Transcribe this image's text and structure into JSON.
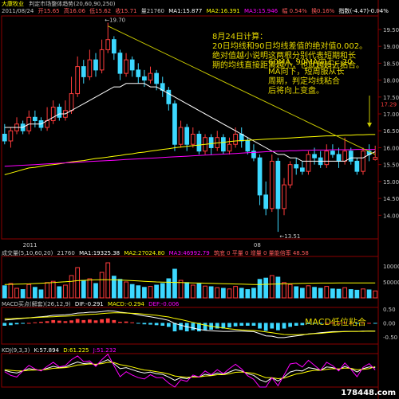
{
  "header": {
    "stock_name": "大康牧业",
    "indicator_title": "判定市场整体趋势(20,60,90,250)",
    "date": "2011/08/24",
    "open": "开15.65",
    "high": "高16.06",
    "low": "低15.62",
    "close": "收15.71",
    "volume": "量21760",
    "ma1": "MA1:15.877",
    "ma2": "MA2:16.391",
    "ma3": "MA3:15.946",
    "amplitude": "幅 0.54%",
    "turnover": "换0.16%",
    "index_label": "指数(-4.47)-0.04%"
  },
  "annotations": {
    "aug24_title": "8月24日计算：",
    "aug24_text": "20日均线和90日均线差值的绝对值0.002。\n绝对值越小说明这两根分别代表短期和长\n期的均线直接距离越小，也就越趋近粘合。",
    "ma60_text": "60MA, 90MA向上，20\nMA向下，短周服从长\n周期，判定均线粘合\n后将向上变盘。",
    "macd_text": "MACD低位粘合"
  },
  "volume_panel": {
    "label": "成交量(5,10,60,20)",
    "value": "21760",
    "ma1": "MA1:19325.38",
    "ma2": "MA2:27024.80",
    "ma3": "MA3:46992.79",
    "extra": "筑底 0  平量 0  增量 0  量能倍率 48.58"
  },
  "macd_panel": {
    "label": "MACD买点(解套)(26,12,9)",
    "dif": "DIF:-0.291",
    "dea": "MACD:-0.294",
    "macd": "DEF:-0.006"
  },
  "kdj_panel": {
    "label": "KDJ(9,3,3)",
    "k": "K:57.894",
    "d": "D:61.225",
    "j": "J:51.232"
  },
  "watermark": "178448.com",
  "chart_data": {
    "type": "candlestick",
    "y_axis": {
      "ticks": [
        14.0,
        14.5,
        15.0,
        15.5,
        16.0,
        16.5,
        17.0,
        17.5,
        18.0,
        18.5,
        19.0,
        19.5
      ],
      "ylim": [
        13.3,
        19.9
      ]
    },
    "x_labels": [
      {
        "index": 3,
        "text": "2011"
      },
      {
        "index": 41,
        "text": "08"
      }
    ],
    "marks": {
      "high_label": "19.70",
      "high_index": 17,
      "low_label": "13.51",
      "low_index": 45,
      "current_price_tag": "17.29"
    },
    "colors": {
      "up": "#ff3c3c",
      "down": "#3cd8ff",
      "ma20": "#ffffff",
      "ma60": "#ffff00",
      "ma90": "#ff00ff",
      "trend": "#c8c800"
    },
    "candles": [
      [
        16.4,
        16.2,
        16.7,
        16.1
      ],
      [
        16.2,
        16.5,
        16.6,
        16.0
      ],
      [
        16.5,
        16.7,
        16.9,
        16.4
      ],
      [
        16.7,
        16.5,
        16.8,
        16.4
      ],
      [
        16.5,
        16.9,
        17.1,
        16.4
      ],
      [
        16.9,
        16.8,
        17.1,
        16.6
      ],
      [
        16.8,
        16.6,
        16.9,
        16.5
      ],
      [
        16.6,
        16.8,
        17.2,
        16.5
      ],
      [
        16.8,
        17.2,
        17.4,
        16.7
      ],
      [
        17.2,
        16.9,
        17.3,
        16.8
      ],
      [
        16.9,
        17.1,
        17.4,
        16.8
      ],
      [
        17.1,
        17.6,
        18.1,
        17.0
      ],
      [
        17.6,
        18.4,
        18.7,
        17.5
      ],
      [
        18.4,
        18.1,
        18.6,
        17.9
      ],
      [
        18.1,
        18.6,
        18.9,
        18.0
      ],
      [
        18.6,
        18.3,
        18.8,
        18.1
      ],
      [
        18.3,
        18.9,
        19.2,
        18.2
      ],
      [
        18.9,
        19.2,
        19.7,
        18.8
      ],
      [
        19.2,
        18.8,
        19.3,
        18.6
      ],
      [
        18.8,
        18.2,
        18.9,
        18.0
      ],
      [
        18.2,
        18.6,
        18.8,
        18.1
      ],
      [
        18.6,
        18.3,
        18.7,
        18.1
      ],
      [
        18.3,
        18.1,
        18.5,
        17.9
      ],
      [
        18.1,
        18.0,
        18.3,
        17.8
      ],
      [
        18.0,
        18.2,
        18.4,
        17.9
      ],
      [
        18.2,
        17.9,
        18.3,
        17.7
      ],
      [
        17.9,
        17.7,
        18.1,
        17.5
      ],
      [
        17.7,
        17.3,
        17.8,
        17.1
      ],
      [
        17.3,
        16.1,
        17.4,
        15.9
      ],
      [
        16.1,
        16.6,
        16.8,
        16.0
      ],
      [
        16.6,
        16.1,
        16.7,
        15.9
      ],
      [
        16.1,
        16.4,
        16.6,
        16.0
      ],
      [
        16.4,
        15.9,
        16.5,
        15.8
      ],
      [
        15.9,
        16.3,
        16.4,
        15.8
      ],
      [
        16.3,
        16.0,
        16.4,
        15.8
      ],
      [
        16.0,
        16.3,
        16.5,
        15.9
      ],
      [
        16.3,
        15.9,
        16.4,
        15.8
      ],
      [
        15.9,
        16.1,
        16.3,
        15.8
      ],
      [
        16.1,
        16.4,
        16.6,
        16.0
      ],
      [
        16.4,
        16.2,
        16.6,
        16.0
      ],
      [
        16.2,
        15.9,
        16.3,
        15.8
      ],
      [
        15.9,
        15.7,
        16.1,
        15.6
      ],
      [
        15.7,
        14.6,
        15.8,
        14.3
      ],
      [
        14.6,
        14.2,
        15.0,
        14.0
      ],
      [
        14.2,
        15.6,
        15.8,
        14.1
      ],
      [
        15.6,
        14.2,
        15.7,
        13.51
      ],
      [
        14.2,
        14.9,
        15.1,
        14.0
      ],
      [
        14.9,
        15.5,
        15.6,
        14.8
      ],
      [
        15.5,
        15.4,
        15.7,
        15.2
      ],
      [
        15.4,
        15.3,
        15.6,
        15.2
      ],
      [
        15.3,
        15.8,
        15.9,
        15.2
      ],
      [
        15.8,
        15.7,
        16.0,
        15.5
      ],
      [
        15.7,
        15.5,
        15.9,
        15.4
      ],
      [
        15.5,
        15.9,
        16.1,
        15.4
      ],
      [
        15.9,
        15.8,
        16.1,
        15.7
      ],
      [
        15.8,
        15.6,
        16.0,
        15.4
      ],
      [
        15.6,
        15.9,
        16.3,
        15.5
      ],
      [
        15.9,
        15.6,
        16.0,
        15.5
      ],
      [
        15.6,
        15.3,
        15.7,
        15.2
      ],
      [
        15.3,
        15.9,
        16.0,
        15.2
      ],
      [
        15.9,
        15.8,
        16.1,
        15.6
      ],
      [
        15.65,
        15.71,
        16.06,
        15.62
      ]
    ],
    "ma20": [
      16.6,
      16.6,
      16.6,
      16.6,
      16.7,
      16.7,
      16.7,
      16.8,
      16.9,
      17.0,
      17.0,
      17.1,
      17.2,
      17.3,
      17.4,
      17.5,
      17.6,
      17.7,
      17.8,
      17.8,
      17.9,
      17.9,
      17.9,
      17.9,
      17.8,
      17.8,
      17.7,
      17.6,
      17.5,
      17.4,
      17.3,
      17.2,
      17.1,
      17.0,
      16.9,
      16.8,
      16.7,
      16.6,
      16.5,
      16.4,
      16.3,
      16.2,
      16.1,
      16.0,
      15.9,
      15.8,
      15.8,
      15.7,
      15.7,
      15.6,
      15.6,
      15.6,
      15.6,
      15.6,
      15.6,
      15.6,
      15.6,
      15.7,
      15.7,
      15.7,
      15.8,
      15.88
    ],
    "ma60": [
      15.2,
      15.25,
      15.3,
      15.35,
      15.4,
      15.42,
      15.45,
      15.48,
      15.5,
      15.52,
      15.55,
      15.58,
      15.6,
      15.62,
      15.65,
      15.68,
      15.7,
      15.72,
      15.75,
      15.77,
      15.8,
      15.82,
      15.85,
      15.87,
      15.9,
      15.92,
      15.95,
      15.97,
      16.0,
      16.02,
      16.04,
      16.06,
      16.08,
      16.1,
      16.12,
      16.14,
      16.16,
      16.18,
      16.2,
      16.21,
      16.22,
      16.23,
      16.24,
      16.25,
      16.26,
      16.27,
      16.28,
      16.29,
      16.3,
      16.31,
      16.32,
      16.33,
      16.34,
      16.35,
      16.35,
      16.36,
      16.37,
      16.37,
      16.38,
      16.38,
      16.39,
      16.39
    ],
    "ma90": [
      15.45,
      15.46,
      15.47,
      15.48,
      15.49,
      15.5,
      15.51,
      15.52,
      15.53,
      15.54,
      15.55,
      15.56,
      15.57,
      15.58,
      15.59,
      15.6,
      15.61,
      15.62,
      15.63,
      15.64,
      15.65,
      15.66,
      15.67,
      15.68,
      15.69,
      15.7,
      15.71,
      15.72,
      15.73,
      15.74,
      15.75,
      15.76,
      15.77,
      15.78,
      15.79,
      15.8,
      15.81,
      15.82,
      15.83,
      15.84,
      15.85,
      15.86,
      15.87,
      15.88,
      15.89,
      15.9,
      15.9,
      15.91,
      15.91,
      15.92,
      15.92,
      15.93,
      15.93,
      15.93,
      15.94,
      15.94,
      15.94,
      15.94,
      15.95,
      15.95,
      15.95,
      15.95
    ],
    "trendline": {
      "from": [
        17,
        19.6
      ],
      "to": [
        61,
        15.8
      ]
    },
    "volume": {
      "ylim": [
        0,
        130000
      ],
      "ticks": [
        50000,
        100000
      ],
      "bars": [
        38000,
        45000,
        30000,
        26000,
        42000,
        33000,
        25000,
        48000,
        52000,
        35000,
        40000,
        70000,
        95000,
        55000,
        60000,
        45000,
        80000,
        110000,
        68000,
        58000,
        50000,
        42000,
        38000,
        33000,
        36000,
        40000,
        45000,
        60000,
        90000,
        55000,
        48000,
        40000,
        44000,
        37000,
        35000,
        32000,
        30000,
        28000,
        36000,
        30000,
        26000,
        30000,
        58000,
        62000,
        70000,
        65000,
        48000,
        42000,
        35000,
        30000,
        38000,
        33000,
        30000,
        36000,
        28000,
        27000,
        32000,
        26000,
        24000,
        28000,
        25000,
        21760
      ],
      "ma": [
        42000,
        42500,
        43000,
        43500,
        44000,
        45000,
        46000,
        47000,
        48000,
        49500,
        50500,
        52000,
        54000,
        55000,
        56000,
        56500,
        57000,
        57000,
        56500,
        56000,
        55000,
        54000,
        53000,
        52000,
        51000,
        50000,
        49500,
        49000,
        48500,
        48000,
        47500,
        47000,
        46500,
        46000,
        45500,
        45000,
        44500,
        44000,
        43500,
        43000,
        42500,
        42000,
        42000,
        42500,
        43000,
        43500,
        44000,
        44500,
        45000,
        45500,
        46000,
        46200,
        46400,
        46500,
        46600,
        46700,
        46800,
        46850,
        46900,
        46950,
        46980,
        46993
      ]
    },
    "macd": {
      "ylim": [
        -0.75,
        0.55
      ],
      "ticks": [
        0.5,
        0.0,
        -0.5
      ],
      "hist": [
        -0.1,
        -0.08,
        -0.05,
        -0.03,
        0.0,
        0.02,
        0.04,
        0.06,
        0.1,
        0.08,
        0.06,
        0.09,
        0.14,
        0.1,
        0.12,
        0.09,
        0.13,
        0.16,
        0.1,
        0.04,
        0.05,
        0.02,
        -0.02,
        -0.05,
        -0.06,
        -0.08,
        -0.1,
        -0.14,
        -0.3,
        -0.25,
        -0.3,
        -0.26,
        -0.3,
        -0.26,
        -0.24,
        -0.2,
        -0.2,
        -0.16,
        -0.12,
        -0.1,
        -0.1,
        -0.1,
        -0.2,
        -0.28,
        -0.2,
        -0.26,
        -0.2,
        -0.14,
        -0.1,
        -0.08,
        -0.04,
        -0.03,
        -0.02,
        0.0,
        0.01,
        0.0,
        0.02,
        0.0,
        -0.02,
        0.01,
        0.0,
        -0.006
      ],
      "dif": [
        0.1,
        0.12,
        0.14,
        0.16,
        0.18,
        0.2,
        0.22,
        0.24,
        0.27,
        0.28,
        0.29,
        0.31,
        0.35,
        0.36,
        0.38,
        0.38,
        0.4,
        0.43,
        0.42,
        0.38,
        0.36,
        0.33,
        0.29,
        0.25,
        0.22,
        0.18,
        0.14,
        0.09,
        -0.02,
        -0.08,
        -0.14,
        -0.18,
        -0.23,
        -0.26,
        -0.28,
        -0.29,
        -0.3,
        -0.3,
        -0.29,
        -0.29,
        -0.3,
        -0.31,
        -0.38,
        -0.46,
        -0.47,
        -0.52,
        -0.52,
        -0.49,
        -0.46,
        -0.43,
        -0.39,
        -0.37,
        -0.35,
        -0.33,
        -0.31,
        -0.31,
        -0.3,
        -0.3,
        -0.3,
        -0.29,
        -0.29,
        -0.291
      ],
      "dea": [
        0.15,
        0.15,
        0.16,
        0.17,
        0.18,
        0.19,
        0.2,
        0.21,
        0.22,
        0.23,
        0.24,
        0.25,
        0.27,
        0.29,
        0.3,
        0.31,
        0.33,
        0.35,
        0.36,
        0.36,
        0.35,
        0.34,
        0.33,
        0.31,
        0.29,
        0.27,
        0.24,
        0.21,
        0.16,
        0.12,
        0.07,
        0.02,
        -0.03,
        -0.08,
        -0.12,
        -0.15,
        -0.18,
        -0.21,
        -0.23,
        -0.25,
        -0.26,
        -0.27,
        -0.29,
        -0.32,
        -0.35,
        -0.38,
        -0.41,
        -0.42,
        -0.42,
        -0.41,
        -0.4,
        -0.38,
        -0.37,
        -0.35,
        -0.33,
        -0.32,
        -0.31,
        -0.3,
        -0.3,
        -0.3,
        -0.29,
        -0.294
      ]
    },
    "kdj": {
      "ylim": [
        0,
        100
      ],
      "k": [
        50,
        45,
        42,
        48,
        55,
        52,
        50,
        56,
        62,
        58,
        60,
        68,
        75,
        70,
        72,
        66,
        74,
        82,
        70,
        55,
        58,
        52,
        46,
        42,
        45,
        40,
        38,
        30,
        20,
        28,
        25,
        32,
        30,
        38,
        35,
        42,
        38,
        45,
        52,
        48,
        40,
        35,
        22,
        15,
        28,
        18,
        30,
        45,
        50,
        48,
        58,
        55,
        50,
        60,
        58,
        52,
        62,
        55,
        45,
        55,
        60,
        57.9
      ],
      "d": [
        52,
        50,
        48,
        48,
        50,
        51,
        51,
        53,
        56,
        57,
        58,
        61,
        66,
        67,
        69,
        68,
        70,
        74,
        73,
        67,
        64,
        60,
        55,
        51,
        49,
        46,
        43,
        39,
        33,
        31,
        29,
        30,
        30,
        33,
        34,
        37,
        37,
        40,
        44,
        45,
        43,
        41,
        35,
        28,
        28,
        25,
        27,
        33,
        39,
        42,
        47,
        50,
        50,
        53,
        55,
        54,
        57,
        56,
        52,
        53,
        55,
        61.2
      ],
      "j": [
        46,
        35,
        30,
        48,
        65,
        54,
        48,
        62,
        74,
        60,
        64,
        82,
        93,
        76,
        78,
        62,
        82,
        98,
        64,
        31,
        46,
        36,
        28,
        24,
        37,
        28,
        28,
        12,
        0,
        22,
        17,
        36,
        30,
        48,
        37,
        52,
        40,
        55,
        68,
        54,
        34,
        23,
        0,
        0,
        28,
        4,
        36,
        69,
        72,
        60,
        80,
        65,
        50,
        74,
        64,
        48,
        72,
        53,
        31,
        59,
        70,
        51.2
      ]
    }
  }
}
